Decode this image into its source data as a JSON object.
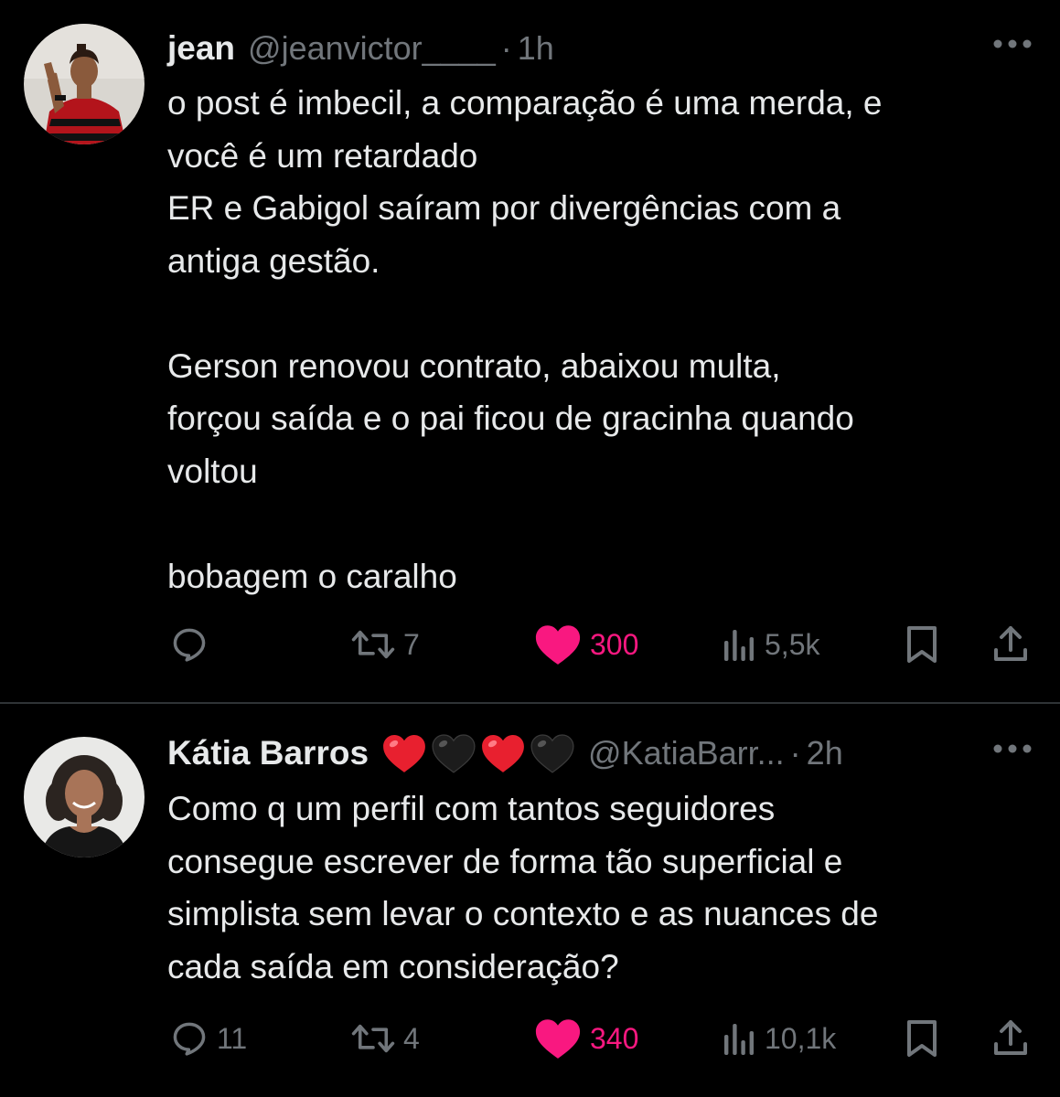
{
  "tweets": [
    {
      "author_name": "jean",
      "author_handle": "@jeanvictor____",
      "separator": "·",
      "time": "1h",
      "emojis": [],
      "text": "o post é imbecil, a comparação é uma merda, e\nvocê é um retardado\nER e Gabigol saíram por divergências com a\nantiga gestão.\n\nGerson renovou contrato, abaixou multa,\nforçou saída e o pai ficou de gracinha quando\nvoltou\n\nbobagem o caralho",
      "replies": "",
      "retweets": "7",
      "likes": "300",
      "views": "5,5k"
    },
    {
      "author_name": "Kátia Barros",
      "author_handle": "@KatiaBarr...",
      "separator": "·",
      "time": "2h",
      "emojis": [
        "red-heart",
        "black-heart",
        "red-heart",
        "black-heart"
      ],
      "text": "Como q um perfil com tantos seguidores\nconsegue escrever de forma tão superficial e\nsimplista sem levar o contexto e as nuances de\ncada saída em consideração?",
      "replies": "11",
      "retweets": "4",
      "likes": "340",
      "views": "10,1k"
    }
  ],
  "icons": {
    "reply": "reply-icon",
    "retweet": "retweet-icon",
    "like": "heart-filled-icon",
    "views": "views-icon",
    "bookmark": "bookmark-icon",
    "share": "share-icon",
    "more": "more-icon"
  },
  "colors": {
    "background": "#000000",
    "text": "#e7e9ea",
    "secondary": "#71767b",
    "like": "#f91880",
    "divider": "#2f3336"
  }
}
